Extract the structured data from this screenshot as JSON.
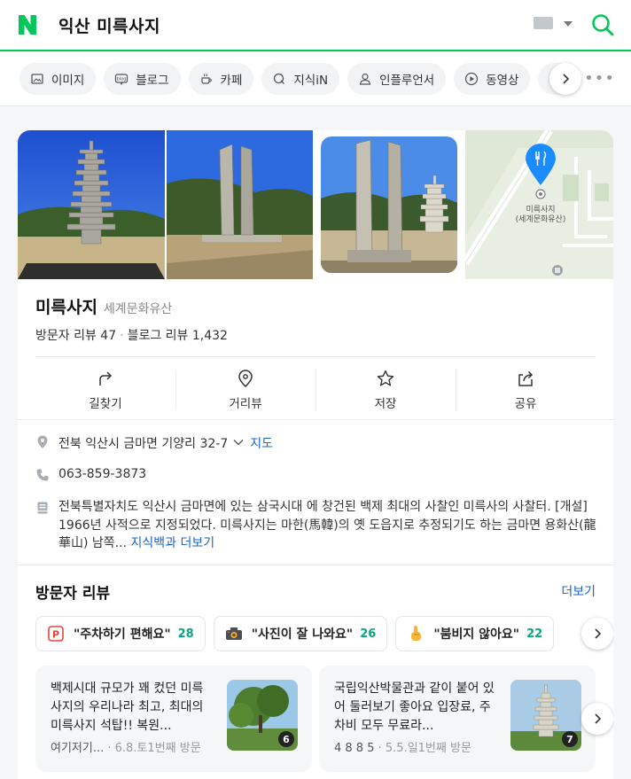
{
  "header": {
    "logo": "naver-n-logo",
    "query": "익산 미륵사지"
  },
  "tabs": [
    {
      "label": "이미지",
      "icon": "image-icon"
    },
    {
      "label": "블로그",
      "icon": "blog-icon"
    },
    {
      "label": "카페",
      "icon": "cafe-cup-icon"
    },
    {
      "label": "지식iN",
      "icon": "knowledge-q-icon"
    },
    {
      "label": "인플루언서",
      "icon": "person-icon"
    },
    {
      "label": "동영상",
      "icon": "play-icon"
    }
  ],
  "place": {
    "name": "미륵사지",
    "category": "세계문화유산",
    "visitor_reviews": "방문자 리뷰 47",
    "dot": "·",
    "blog_reviews": "블로그 리뷰 1,432",
    "map_label_line1": "미륵사지",
    "map_label_line2": "(세계문화유산)"
  },
  "actions": [
    {
      "label": "길찾기",
      "icon": "directions-icon"
    },
    {
      "label": "거리뷰",
      "icon": "streetview-pin-icon"
    },
    {
      "label": "저장",
      "icon": "star-icon"
    },
    {
      "label": "공유",
      "icon": "share-icon"
    }
  ],
  "info": {
    "address": "전북 익산시 금마면 기양리 32-7",
    "map_link": "지도",
    "phone": "063-859-3873",
    "description": "전북특별자치도 익산시 금마면에 있는 삼국시대 에 창건된 백제 최대의 사찰인 미륵사의 사찰터. [개설] 1966년 사적으로 지정되었다. 미륵사지는 마한(馬韓)의 옛 도읍지로 추정되기도 하는 금마면 용화산(龍華山) 남쪽...",
    "desc_link": "지식백과 더보기"
  },
  "reviews": {
    "title": "방문자 리뷰",
    "more": "더보기",
    "keywords": [
      {
        "text": "\"주차하기 편해요\"",
        "count": "28",
        "icon": "parking-icon"
      },
      {
        "text": "\"사진이 잘 나와요\"",
        "count": "26",
        "icon": "camera-icon"
      },
      {
        "text": "\"붐비지 않아요\"",
        "count": "22",
        "icon": "pointing-hand-icon"
      }
    ],
    "cards": [
      {
        "text": "백제시대 규모가 꽤 컸던 미륵사지의 우리나라 최고, 최대의 미륵사지 석탑!! 복원...",
        "author": "여기저기...",
        "meta": "· 6.8.토1번째 방문",
        "photo_count": "6"
      },
      {
        "text": "국립익산박물관과 같이 붙어 있어 둘러보기 좋아요 입장료, 주차비 모두 무료라...",
        "author": "4 8 8 5",
        "meta": "· 5.5.일1번째 방문",
        "photo_count": "7"
      }
    ]
  },
  "colors": {
    "brand": "#03c75a",
    "link": "#1a62d6",
    "count": "#0aa77f"
  }
}
